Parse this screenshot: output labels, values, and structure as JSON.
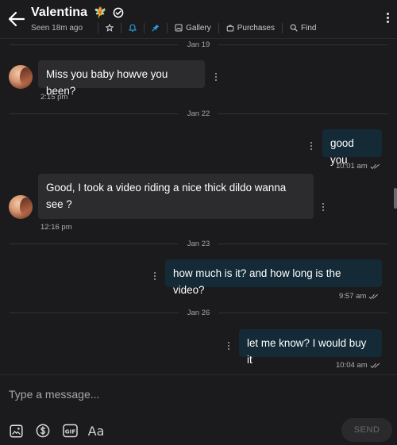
{
  "header": {
    "contact_name": "Valentina",
    "name_emoji": "🧚",
    "status": "Seen 18m ago",
    "gallery_label": "Gallery",
    "purchases_label": "Purchases",
    "find_label": "Find",
    "icons": [
      "back-arrow-icon",
      "verified-icon",
      "star-icon",
      "bell-icon",
      "pin-icon",
      "gallery-icon",
      "purchases-icon",
      "search-icon",
      "more-vertical-icon"
    ],
    "accent_color": "#2aa0e0"
  },
  "messages": [
    {
      "type": "date",
      "label": "Jan 19"
    },
    {
      "type": "in",
      "text": "Miss you baby howve you been?",
      "time": "2:15 pm"
    },
    {
      "type": "date",
      "label": "Jan 22"
    },
    {
      "type": "out",
      "text": "good you",
      "time": "10:01 am"
    },
    {
      "type": "in",
      "text": "Good, I took a video riding a nice thick dildo wanna see ?",
      "time": "12:16 pm"
    },
    {
      "type": "date",
      "label": "Jan 23"
    },
    {
      "type": "out",
      "text": "how much is it? and how long is the video?",
      "time": "9:57 am"
    },
    {
      "type": "date",
      "label": "Jan 26"
    },
    {
      "type": "out",
      "text": "let me know? I would buy it",
      "time": "10:04 am"
    }
  ],
  "composer": {
    "placeholder": "Type a message...",
    "send_label": "SEND",
    "font_tool_label": "Aa",
    "gif_label": "GIF",
    "tools": [
      "image-icon",
      "dollar-icon",
      "gif-icon",
      "text-format-icon"
    ]
  }
}
